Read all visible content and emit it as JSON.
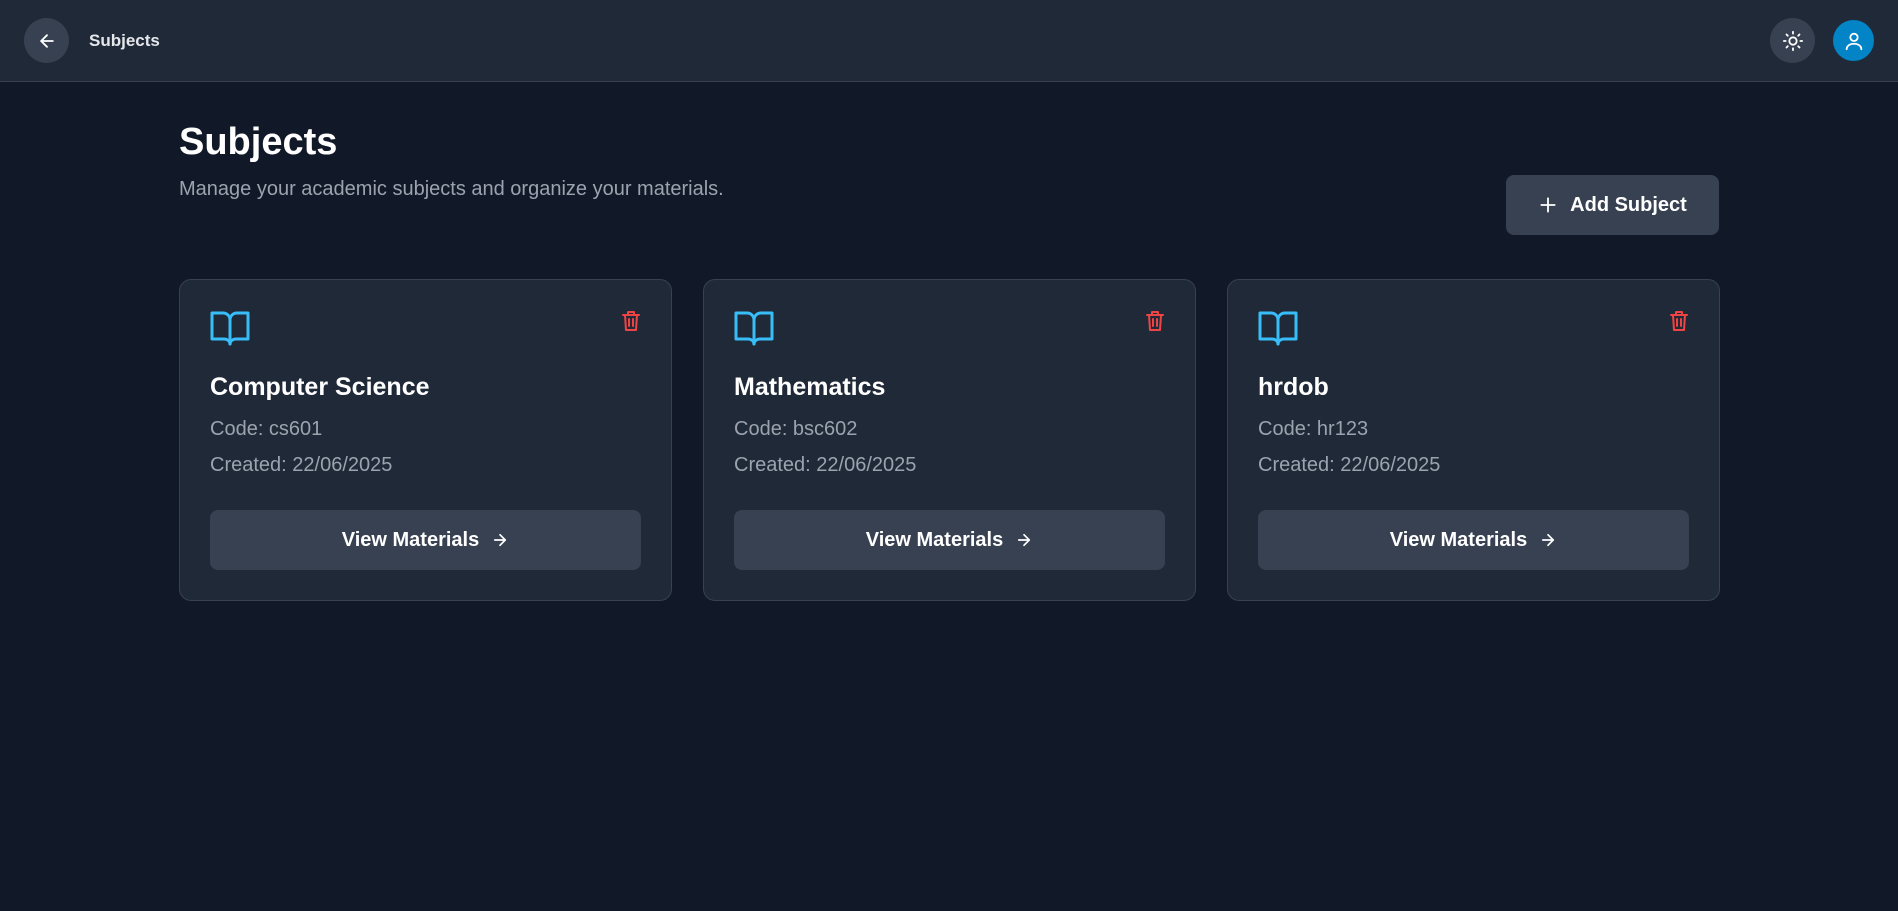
{
  "topbar": {
    "title": "Subjects",
    "back_icon": "arrow-left-icon",
    "theme_icon": "sun-icon",
    "avatar_icon": "user-icon"
  },
  "page": {
    "title": "Subjects",
    "subtitle": "Manage your academic subjects and organize your materials.",
    "add_button_label": "Add Subject"
  },
  "subjects": [
    {
      "name": "Computer Science",
      "code": "Code: cs601",
      "created": "Created: 22/06/2025",
      "button_label": "View Materials"
    },
    {
      "name": "Mathematics",
      "code": "Code: bsc602",
      "created": "Created: 22/06/2025",
      "button_label": "View Materials"
    },
    {
      "name": "hrdob",
      "code": "Code: hr123",
      "created": "Created: 22/06/2025",
      "button_label": "View Materials"
    }
  ],
  "colors": {
    "background": "#111827",
    "surface": "#1f2937",
    "accent": "#38bdf8",
    "danger": "#ef4444",
    "avatar": "#0284c7"
  }
}
